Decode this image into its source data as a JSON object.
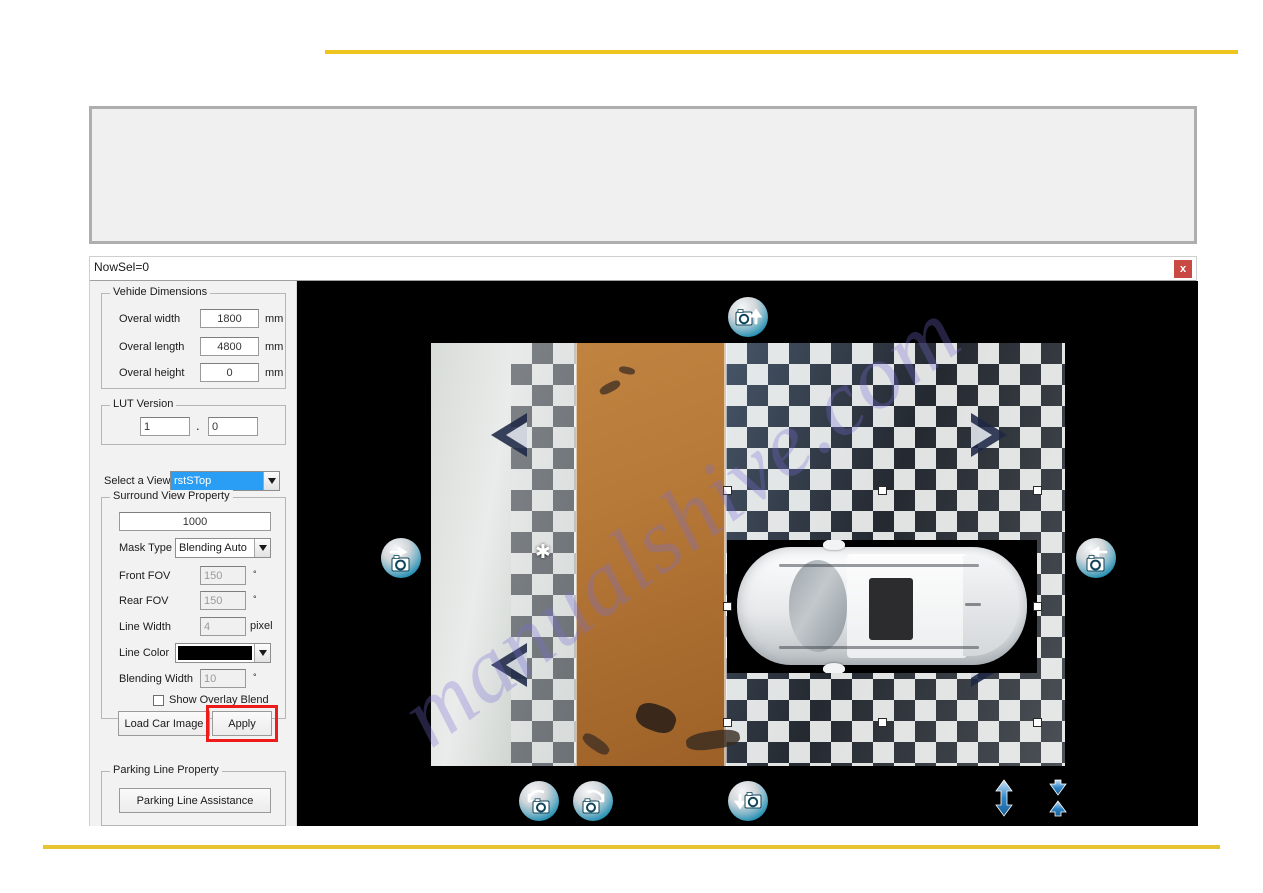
{
  "window": {
    "title": "NowSel=0",
    "close_label": "x"
  },
  "vehicle_dimensions": {
    "legend": "Vehide Dimensions",
    "fields": [
      {
        "label": "Overal width",
        "value": "1800",
        "unit": "mm"
      },
      {
        "label": "Overal length",
        "value": "4800",
        "unit": "mm"
      },
      {
        "label": "Overal height",
        "value": "0",
        "unit": "mm"
      }
    ]
  },
  "lut_version": {
    "legend": "LUT Version",
    "major": "1",
    "separator": ".",
    "minor": "0"
  },
  "select_view": {
    "label": "Select a View",
    "value": "rstSTop"
  },
  "surround_view": {
    "legend": "Surround View Property",
    "scale_value": "1000",
    "mask_type_label": "Mask Type",
    "mask_type_value": "Blending Auto",
    "front_fov_label": "Front FOV",
    "front_fov_value": "150",
    "front_fov_unit": "°",
    "rear_fov_label": "Rear FOV",
    "rear_fov_value": "150",
    "rear_fov_unit": "°",
    "line_width_label": "Line Width",
    "line_width_value": "4",
    "line_width_unit": "pixel",
    "line_color_label": "Line Color",
    "line_color_value": "#000000",
    "blending_width_label": "Blending Width",
    "blending_width_value": "10",
    "blending_width_unit": "°",
    "show_overlay_blend_label": "Show Overlay Blend",
    "load_car_image_label": "Load Car Image",
    "apply_label": "Apply"
  },
  "parking_line": {
    "legend": "Parking Line Property",
    "button_label": "Parking Line Assistance"
  },
  "viewer": {
    "tools": [
      {
        "name": "camera-up-icon",
        "title": "Top camera"
      },
      {
        "name": "camera-left-icon",
        "title": "Left camera"
      },
      {
        "name": "camera-right-icon",
        "title": "Right camera"
      },
      {
        "name": "camera-rotate-left-icon",
        "title": "Rotate left"
      },
      {
        "name": "camera-rotate-right-icon",
        "title": "Rotate right"
      },
      {
        "name": "camera-down-icon",
        "title": "Bottom camera"
      },
      {
        "name": "stretch-vertical-icon",
        "title": "Stretch"
      },
      {
        "name": "shrink-vertical-icon",
        "title": "Shrink"
      }
    ]
  },
  "watermark": {
    "text": "manualshive.com"
  },
  "colors": {
    "accent_rule": "#f0c41e",
    "highlight": "#ee1b1b",
    "selection": "#2a9df4",
    "close": "#c94a45"
  }
}
